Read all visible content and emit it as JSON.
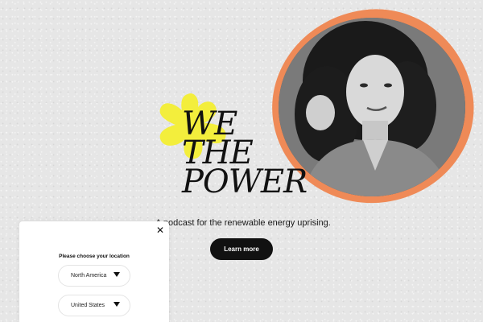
{
  "hero": {
    "title_lines": [
      "WE",
      "THE",
      "POWER"
    ],
    "tagline": "A podcast for the renewable energy uprising.",
    "cta_label": "Learn more"
  },
  "location_popup": {
    "close_glyph": "✕",
    "heading": "Please choose your location",
    "region_select": {
      "value": "North America",
      "icon": "chevron-down-icon"
    },
    "country_select": {
      "value": "United States",
      "icon": "chevron-down-icon"
    }
  },
  "colors": {
    "background": "#e6e6e6",
    "accent_yellow": "#f3ee3c",
    "accent_orange": "#ef8a57",
    "button_dark": "#111111"
  }
}
